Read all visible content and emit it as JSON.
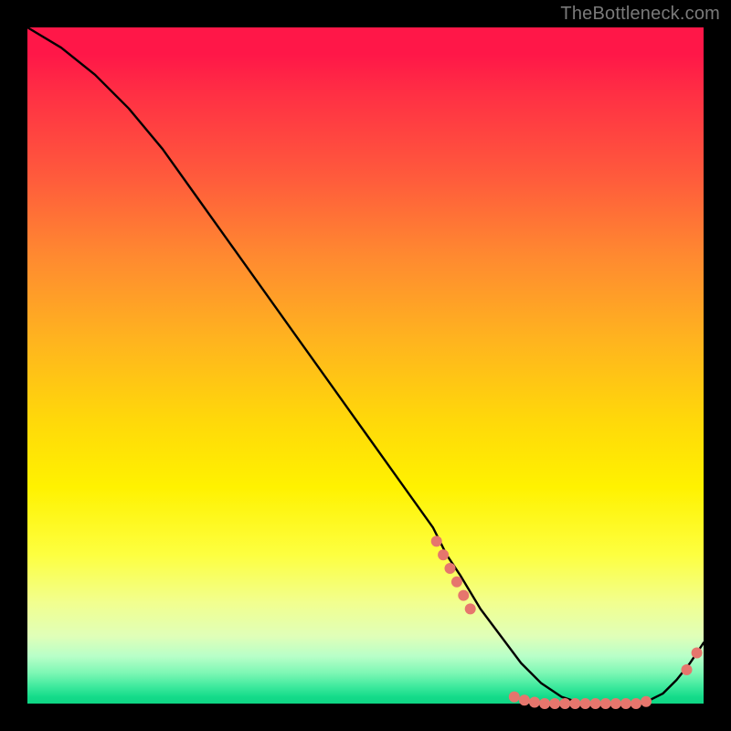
{
  "watermark": "TheBottleneck.com",
  "chart_data": {
    "type": "line",
    "title": "",
    "xlabel": "",
    "ylabel": "",
    "xlim": [
      0,
      100
    ],
    "ylim": [
      0,
      100
    ],
    "background_gradient": {
      "top": "#ff1748",
      "upper_mid": "#ffb31f",
      "mid": "#fff200",
      "lower": "#b8ffc8",
      "bottom": "#0fd584"
    },
    "series": [
      {
        "name": "bottleneck-curve",
        "color": "#000000",
        "x": [
          0,
          5,
          10,
          15,
          20,
          25,
          30,
          35,
          40,
          45,
          50,
          55,
          60,
          62,
          64,
          67,
          70,
          73,
          76,
          79,
          82,
          85,
          88,
          90,
          92,
          94,
          96,
          98,
          100
        ],
        "y": [
          100,
          97,
          93,
          88,
          82,
          75,
          68,
          61,
          54,
          47,
          40,
          33,
          26,
          22,
          19,
          14,
          10,
          6,
          3,
          1,
          0,
          0,
          0,
          0,
          0.5,
          1.5,
          3.5,
          6,
          9
        ]
      }
    ],
    "points": {
      "name": "data-dots",
      "color": "#e6766d",
      "radius": 6,
      "coords": [
        {
          "x": 60.5,
          "y": 24
        },
        {
          "x": 61.5,
          "y": 22
        },
        {
          "x": 62.5,
          "y": 20
        },
        {
          "x": 63.5,
          "y": 18
        },
        {
          "x": 64.5,
          "y": 16
        },
        {
          "x": 65.5,
          "y": 14
        },
        {
          "x": 72.0,
          "y": 1
        },
        {
          "x": 73.5,
          "y": 0.5
        },
        {
          "x": 75.0,
          "y": 0.2
        },
        {
          "x": 76.5,
          "y": 0
        },
        {
          "x": 78.0,
          "y": 0
        },
        {
          "x": 79.5,
          "y": 0
        },
        {
          "x": 81.0,
          "y": 0
        },
        {
          "x": 82.5,
          "y": 0
        },
        {
          "x": 84.0,
          "y": 0
        },
        {
          "x": 85.5,
          "y": 0
        },
        {
          "x": 87.0,
          "y": 0
        },
        {
          "x": 88.5,
          "y": 0
        },
        {
          "x": 90.0,
          "y": 0
        },
        {
          "x": 91.5,
          "y": 0.3
        },
        {
          "x": 97.5,
          "y": 5
        },
        {
          "x": 99.0,
          "y": 7.5
        }
      ]
    }
  }
}
